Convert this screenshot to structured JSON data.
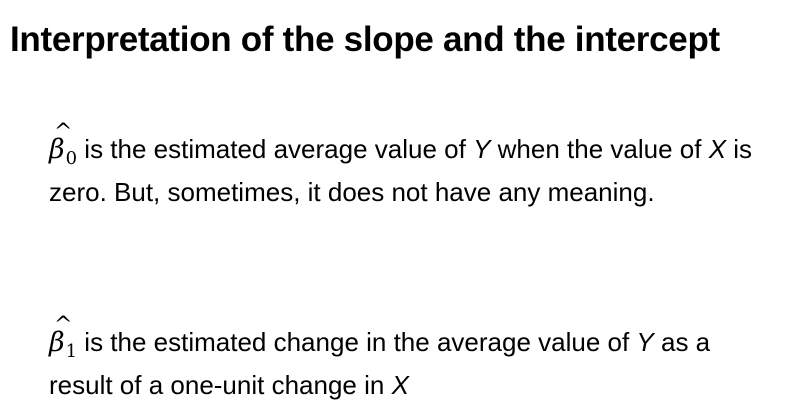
{
  "slide": {
    "title": "Interpretation of the slope and the intercept",
    "symbols": {
      "beta": "β",
      "hat": "^",
      "sub_0": "0",
      "sub_1": "1"
    },
    "intercept": {
      "part1": " is the estimated average value of ",
      "var_y": "Y",
      "part2": " when the value of ",
      "var_x": "X",
      "part3": " is zero.  But, sometimes, it does not have any meaning."
    },
    "slope": {
      "part1": " is the estimated change in the average value of ",
      "var_y": "Y",
      "part2": " as a result of a one-unit change in ",
      "var_x": "X"
    }
  }
}
